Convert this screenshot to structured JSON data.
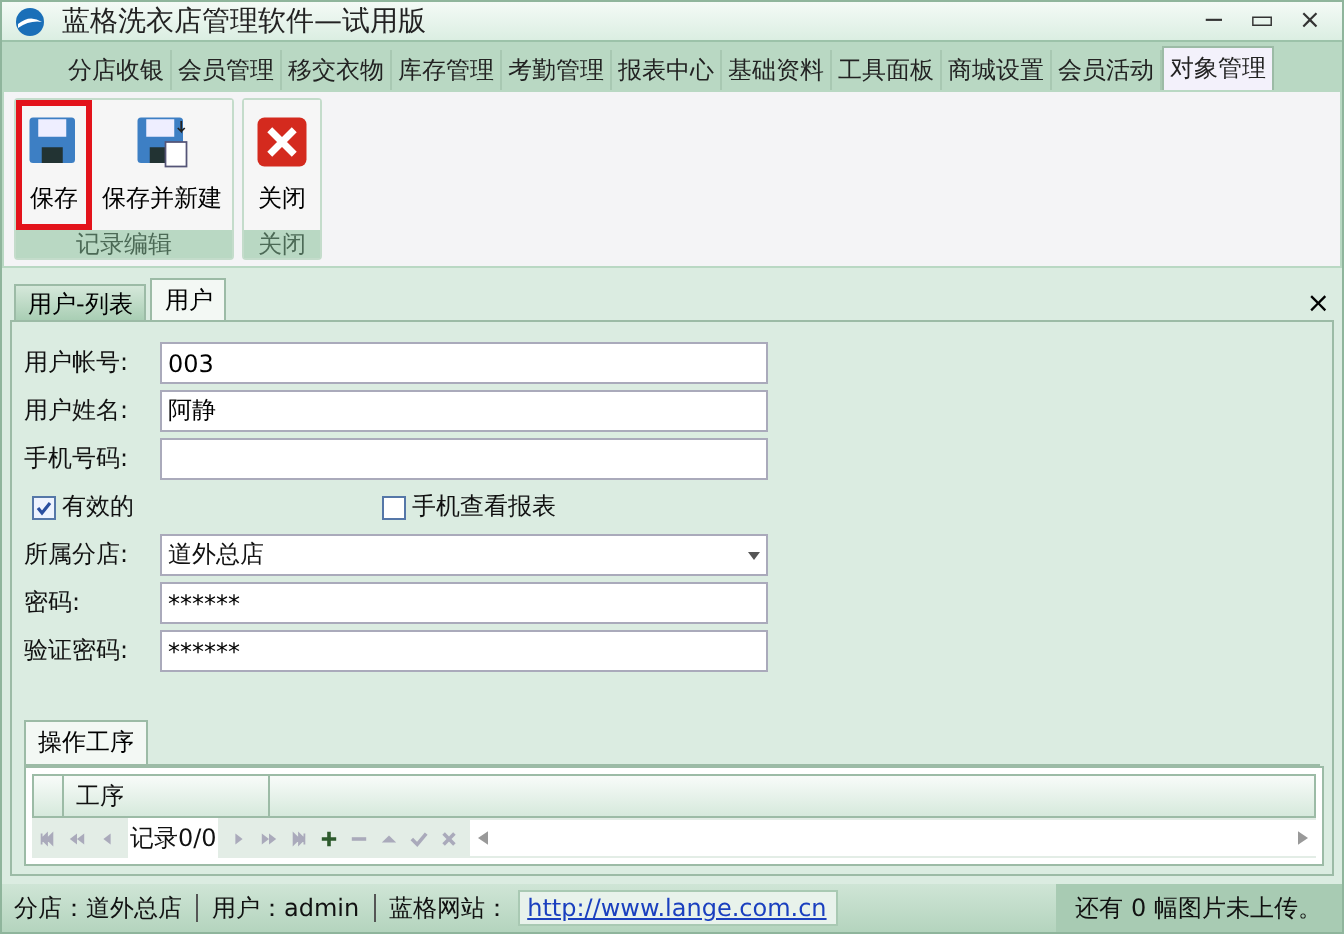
{
  "window": {
    "title": "蓝格洗衣店管理软件—试用版",
    "controls": [
      "−",
      "▭",
      "×"
    ]
  },
  "menu_tabs": [
    {
      "label": "分店收银",
      "selected": false
    },
    {
      "label": "会员管理",
      "selected": false
    },
    {
      "label": "移交衣物",
      "selected": false
    },
    {
      "label": "库存管理",
      "selected": false
    },
    {
      "label": "考勤管理",
      "selected": false
    },
    {
      "label": "报表中心",
      "selected": false
    },
    {
      "label": "基础资料",
      "selected": false
    },
    {
      "label": "工具面板",
      "selected": false
    },
    {
      "label": "商城设置",
      "selected": false
    },
    {
      "label": "会员活动",
      "selected": false
    },
    {
      "label": "对象管理",
      "selected": true
    }
  ],
  "ribbon_groups": [
    {
      "title": "记录编辑",
      "buttons": [
        {
          "label": "保存",
          "kind": "save",
          "highlighted": true
        },
        {
          "label": "保存并新建",
          "kind": "save-new",
          "highlighted": false
        }
      ]
    },
    {
      "title": "关闭",
      "buttons": [
        {
          "label": "关闭",
          "kind": "close",
          "highlighted": false
        }
      ]
    }
  ],
  "doc_tabs": [
    {
      "label": "用户-列表",
      "selected": false
    },
    {
      "label": "用户",
      "selected": true
    }
  ],
  "doc_close": "×",
  "form": [
    {
      "kind": "text",
      "label": "用户帐号:",
      "value": "003"
    },
    {
      "kind": "text",
      "label": "用户姓名:",
      "value": "阿静"
    },
    {
      "kind": "text",
      "label": "手机号码:"
    },
    {
      "kind": "checks",
      "items": [
        {
          "label": "有效的",
          "checked": true
        },
        {
          "label": "手机查看报表",
          "checked": false
        }
      ]
    },
    {
      "kind": "select",
      "label": "所属分店:",
      "value": "道外总店"
    },
    {
      "kind": "text",
      "label": "密码:",
      "value": "******"
    },
    {
      "kind": "text",
      "label": "验证密码:",
      "value": "******"
    }
  ],
  "sub_tabs": [
    {
      "label": "操作工序"
    }
  ],
  "grid": {
    "columns": [
      "工序"
    ],
    "record": "记录0/0"
  },
  "status_bar": {
    "branch": "分店：道外总店",
    "user": "用户：admin",
    "site_label": "蓝格网站：",
    "site_link": "http://www.lange.com.cn",
    "upload": "还有 0 幅图片未上传。"
  }
}
